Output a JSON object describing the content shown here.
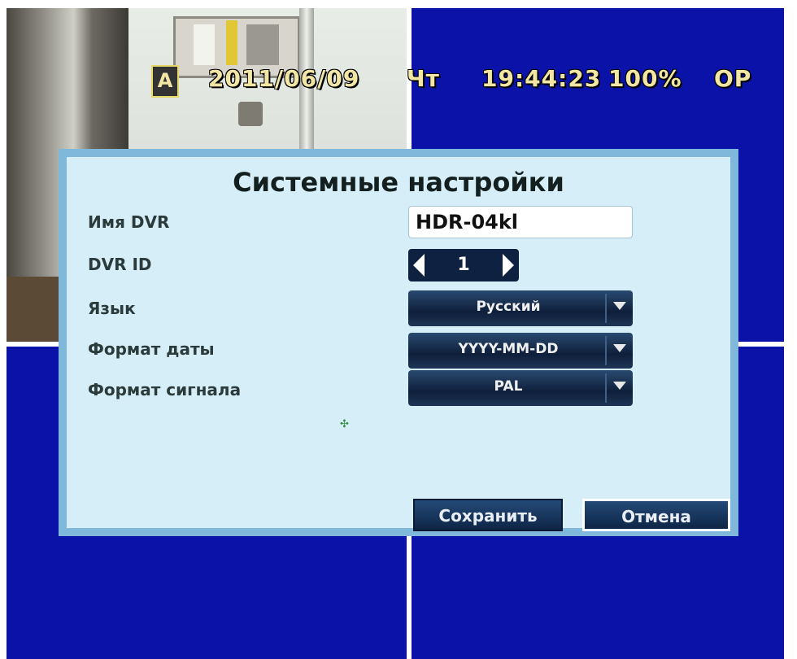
{
  "osd": {
    "camera_badge": "A",
    "date": "2011/06/09",
    "weekday": "Чт",
    "time": "19:44:23",
    "disk_usage": "100%",
    "mode": "OP"
  },
  "dialog": {
    "title": "Системные настройки",
    "fields": {
      "dvr_name": {
        "label": "Имя DVR",
        "value": "HDR-04kl"
      },
      "dvr_id": {
        "label": "DVR ID",
        "value": "1"
      },
      "language": {
        "label": "Язык",
        "value": "Русский"
      },
      "date_format": {
        "label": "Формат даты",
        "value": "YYYY-MM-DD"
      },
      "signal_format": {
        "label": "Формат сигнала",
        "value": "PAL"
      }
    },
    "buttons": {
      "save": "Сохранить",
      "cancel": "Отмена"
    }
  },
  "icons": {
    "stepper_decrement": "chevron-left-icon",
    "stepper_increment": "chevron-right-icon",
    "dropdown": "chevron-down-icon",
    "cursor": "cursor-icon"
  },
  "colors": {
    "screen_background": "#0a12a8",
    "dialog_background": "#d6eef8",
    "dialog_border": "#7fb8da",
    "control_dark": "#0e2140",
    "osd_text": "#f2e6a5"
  }
}
